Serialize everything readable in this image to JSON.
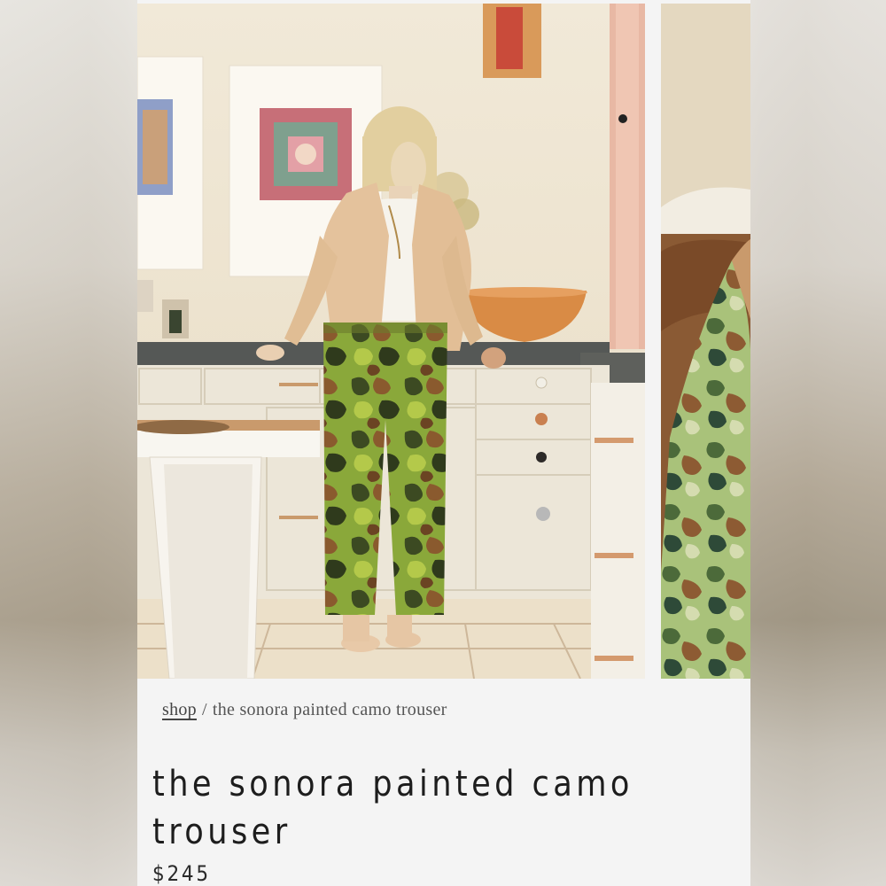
{
  "breadcrumb": {
    "shop_label": "shop",
    "separator": "/",
    "current": "the sonora painted camo trouser"
  },
  "product": {
    "title": "the sonora painted camo trouser",
    "price": "$245"
  },
  "gallery": {
    "images": [
      "product-photo-main",
      "product-photo-detail"
    ]
  },
  "colors": {
    "page_background": "#f4f4f4",
    "title_text": "#1d1d1d",
    "breadcrumb_text": "#555555"
  }
}
